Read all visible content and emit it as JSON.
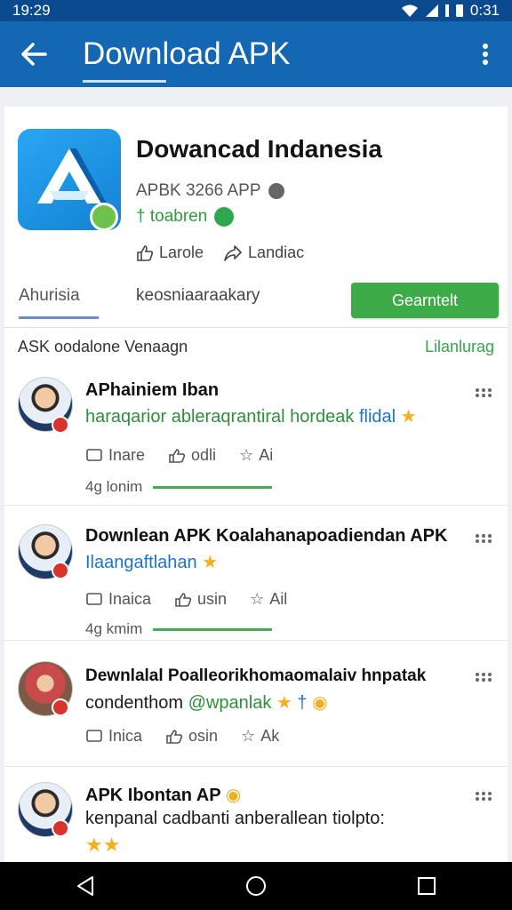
{
  "status": {
    "time_left": "19:29",
    "time_right": "0:31"
  },
  "appbar": {
    "title": "Download APK"
  },
  "app": {
    "name": "Dowancad Indanesia",
    "subtitle": "APBK 3266 APP",
    "developer": "† toabren",
    "actions": [
      {
        "label": "Larole",
        "icon": "thumbs-up-icon"
      },
      {
        "label": "Landiac",
        "icon": "share-icon"
      }
    ]
  },
  "tabs": {
    "tab1": "Ahurisia",
    "tab2": "keosniaaraakary",
    "download_button": "Gearntelt"
  },
  "section": {
    "heading": "ASK oodalone Venaagn",
    "link": "Lilanlurag"
  },
  "posts": [
    {
      "title": "APhainiem Iban",
      "text_plain": "haraqarior ableraqrantiral hordeak",
      "text_highlight": "flidal",
      "actions": [
        "Inare",
        "odli",
        "Ai"
      ],
      "progress_label": "4g lonim",
      "progress": 1.0
    },
    {
      "title": "Downlean APK Koalahanapoadiendan APK",
      "text_highlight": "Ilaangaftlahan",
      "actions": [
        "Inaica",
        "usin",
        "Ail"
      ],
      "progress_label": "4g kmim",
      "progress": 1.0
    },
    {
      "title": "Dewnlalal Poalleorikhomaomalaiv hnpatak",
      "text_plain": "condenthom",
      "text_highlight": "@wpanlak",
      "actions": [
        "Inica",
        "osin",
        "Ak"
      ]
    },
    {
      "title": "APK Ibontan AP",
      "text_plain": "kenpanal cadbanti anberallean tiolpto:"
    }
  ]
}
